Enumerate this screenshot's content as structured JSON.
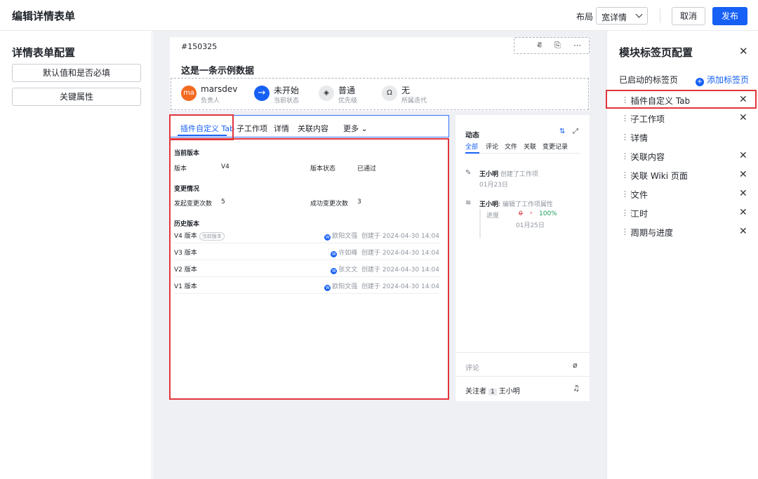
{
  "topbar": {
    "title": "编辑详情表单",
    "layout_label": "布局",
    "layout_value": "宽详情",
    "cancel_label": "取消",
    "publish_label": "发布"
  },
  "left_panel": {
    "title": "详情表单配置",
    "buttons": [
      "默认值和是否必填",
      "关键属性"
    ]
  },
  "work_item": {
    "id": "#150325",
    "title": "这是一条示例数据",
    "attributes": [
      {
        "avatar": "ma",
        "value": "marsdev",
        "label": "负责人"
      },
      {
        "icon": "arrow-right-icon",
        "value": "未开始",
        "label": "当前状态"
      },
      {
        "icon": "priority-icon",
        "value": "普通",
        "label": "优先级"
      },
      {
        "icon": "iteration-icon",
        "value": "无",
        "label": "所属迭代"
      }
    ]
  },
  "detail_tabs": {
    "tabs": [
      "插件自定义 Tab",
      "子工作项",
      "详情",
      "关联内容",
      "更多"
    ],
    "active": 0
  },
  "plugin_content": {
    "current_version_title": "当前版本",
    "version_label": "版本",
    "version_value": "V4",
    "version_status_label": "版本状态",
    "version_status_value": "已通过",
    "change_title": "变更情况",
    "initiated_label": "发起变更次数",
    "initiated_value": "5",
    "success_label": "成功变更次数",
    "success_value": "3",
    "history_title": "历史版本",
    "history": [
      {
        "name": "V4 版本",
        "tag": "当前版本",
        "user": "欧阳文强",
        "created": "创建于 2024-04-30 14:04"
      },
      {
        "name": "V3 版本",
        "tag": "",
        "user": "许如峰",
        "created": "创建于 2024-04-30 14:04"
      },
      {
        "name": "V2 版本",
        "tag": "",
        "user": "张文文",
        "created": "创建于 2024-04-30 14:04"
      },
      {
        "name": "V1 版本",
        "tag": "",
        "user": "欧阳文强",
        "created": "创建于 2024-04-30 14:04"
      }
    ]
  },
  "activity": {
    "title": "动态",
    "subtabs": [
      "全部",
      "评论",
      "文件",
      "关联",
      "变更记录"
    ],
    "items": [
      {
        "user": "王小明",
        "action": "创建了工作项",
        "date": "01月23日"
      },
      {
        "user": "王小明",
        "action": "编辑了工作项属性",
        "date": ""
      }
    ],
    "progress_label": "进度",
    "progress_old": "0",
    "progress_new": "100%",
    "progress_date": "01月25日",
    "comment_placeholder": "评论",
    "followers_label": "关注者",
    "followers_count": "1",
    "followers_name": "王小明"
  },
  "right_panel": {
    "title": "模块标签页配置",
    "enabled_label": "已启动的标签页",
    "add_label": "添加标签页",
    "tabs": [
      {
        "label": "插件自定义 Tab",
        "removable": true
      },
      {
        "label": "子工作项",
        "removable": true
      },
      {
        "label": "详情",
        "removable": false
      },
      {
        "label": "关联内容",
        "removable": true
      },
      {
        "label": "关联 Wiki 页面",
        "removable": true
      },
      {
        "label": "文件",
        "removable": true
      },
      {
        "label": "工时",
        "removable": true
      },
      {
        "label": "周期与进度",
        "removable": true
      }
    ]
  },
  "colors": {
    "primary": "#1660f5",
    "highlight": "#e0353b",
    "avatar": "#f26a21"
  }
}
